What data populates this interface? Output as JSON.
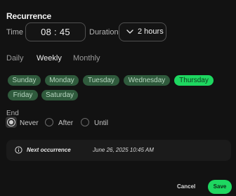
{
  "title": "Recurrence",
  "time": {
    "label": "Time",
    "value": "08 : 45"
  },
  "duration": {
    "label": "Duration",
    "value": "2 hours",
    "icon": "chevron-down-icon"
  },
  "frequency_tabs": [
    {
      "label": "Daily",
      "active": false
    },
    {
      "label": "Weekly",
      "active": true
    },
    {
      "label": "Monthly",
      "active": false
    }
  ],
  "days": [
    {
      "label": "Sunday",
      "selected": false
    },
    {
      "label": "Monday",
      "selected": false
    },
    {
      "label": "Tuesday",
      "selected": false
    },
    {
      "label": "Wednesday",
      "selected": false
    },
    {
      "label": "Thursday",
      "selected": true
    },
    {
      "label": "Friday",
      "selected": false
    },
    {
      "label": "Saturday",
      "selected": false
    }
  ],
  "end": {
    "label": "End",
    "options": [
      {
        "label": "Never",
        "selected": true
      },
      {
        "label": "After",
        "selected": false
      },
      {
        "label": "Until",
        "selected": false
      }
    ]
  },
  "next_occurrence": {
    "icon": "info-icon",
    "label": "Next occurrence",
    "value": "June 26, 2025 10:45 AM"
  },
  "actions": {
    "cancel": "Cancel",
    "save": "Save"
  },
  "colors": {
    "accent": "#1ed760",
    "chip_unselected": "#2f5a3c",
    "background": "#121212"
  }
}
